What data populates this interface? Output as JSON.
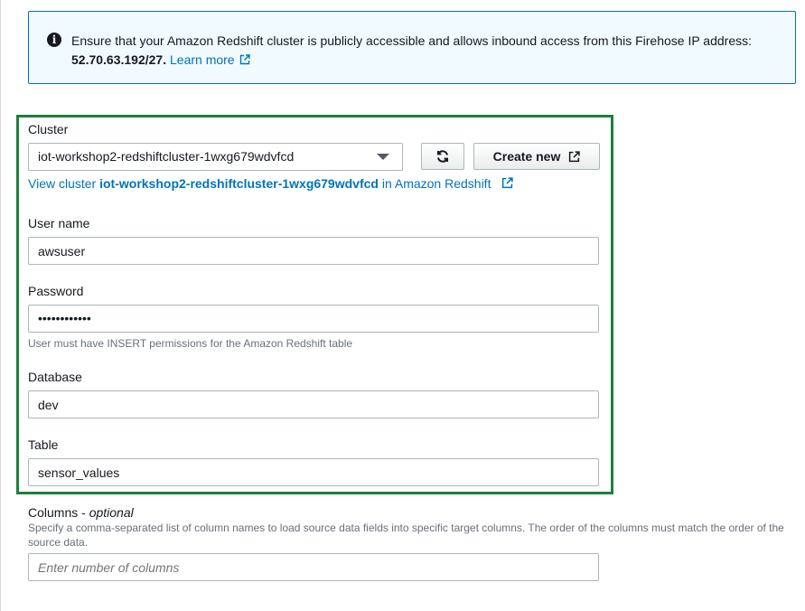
{
  "info": {
    "message": "Ensure that your Amazon Redshift cluster is publicly accessible and allows inbound access from this Firehose IP address:",
    "ip": "52.70.63.192/27.",
    "learn_more": "Learn more",
    "icon": "info-icon"
  },
  "cluster": {
    "label": "Cluster",
    "selected": "iot-workshop2-redshiftcluster-1wxg679wdvfcd",
    "refresh_icon": "refresh-icon",
    "create_new": "Create new",
    "view_prefix": "View cluster",
    "view_name": "iot-workshop2-redshiftcluster-1wxg679wdvfcd",
    "view_suffix": "in Amazon Redshift"
  },
  "user_name": {
    "label": "User name",
    "value": "awsuser"
  },
  "password": {
    "label": "Password",
    "value": "••••••••••••",
    "hint": "User must have INSERT permissions for the Amazon Redshift table"
  },
  "database": {
    "label": "Database",
    "value": "dev"
  },
  "table": {
    "label": "Table",
    "value": "sensor_values"
  },
  "columns": {
    "label": "Columns -",
    "optional": "optional",
    "description": "Specify a comma-separated list of column names to load source data fields into specific target columns. The order of the columns must match the order of the source data.",
    "placeholder": "Enter number of columns"
  },
  "colors": {
    "accent": "#0073bb",
    "highlight_frame": "#1e7f3b",
    "info_bg": "#f1faff"
  }
}
